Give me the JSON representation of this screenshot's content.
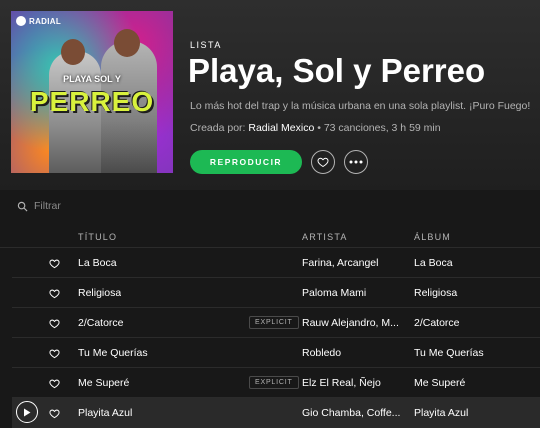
{
  "playlist": {
    "cover": {
      "brand": "RADIAL",
      "subtitle": "PLAYA SOL Y",
      "big_title": "PERREO"
    },
    "kind": "LISTA",
    "title": "Playa, Sol y Perreo",
    "description": "Lo más hot del trap y la música urbana en una sola playlist. ¡Puro Fuego!",
    "created_by_label": "Creada por:",
    "owner": "Radial Mexico",
    "stats": " • 73 canciones, 3 h 59 min"
  },
  "actions": {
    "play_label": "REPRODUCIR",
    "like_icon": "heart-outline-icon",
    "more_icon": "ellipsis-icon"
  },
  "filter": {
    "placeholder": "Filtrar",
    "icon": "search-icon"
  },
  "table": {
    "headers": {
      "title": "TÍTULO",
      "artist": "ARTISTA",
      "album": "ÁLBUM"
    },
    "tracks": [
      {
        "title": "La Boca",
        "explicit": "",
        "artist": "Farina, Arcangel",
        "album": "La Boca"
      },
      {
        "title": "Religiosa",
        "explicit": "",
        "artist": "Paloma Mami",
        "album": "Religiosa"
      },
      {
        "title": "2/Catorce",
        "explicit": "EXPLICIT",
        "artist": "Rauw Alejandro, M...",
        "album": "2/Catorce"
      },
      {
        "title": "Tu Me Querías",
        "explicit": "",
        "artist": "Robledo",
        "album": "Tu Me Querías"
      },
      {
        "title": "Me Superé",
        "explicit": "EXPLICIT",
        "artist": "Elz El Real, Ñejo",
        "album": "Me Superé"
      },
      {
        "title": "Playita Azul",
        "explicit": "",
        "artist": "Gio Chamba, Coffe...",
        "album": "Playita Azul"
      }
    ]
  },
  "colors": {
    "accent": "#1db954",
    "background": "#181818",
    "secondary_text": "#b3b3b3",
    "cover_title": "#d9f23d"
  }
}
